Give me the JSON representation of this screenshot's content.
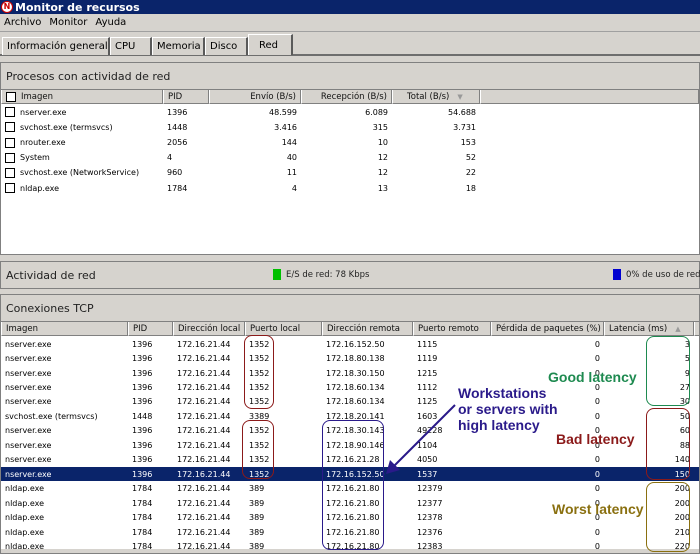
{
  "window": {
    "title": "Monitor de recursos"
  },
  "menu": [
    "Archivo",
    "Monitor",
    "Ayuda"
  ],
  "tabs": [
    {
      "label": "Información general",
      "active": false
    },
    {
      "label": "CPU",
      "active": false
    },
    {
      "label": "Memoria",
      "active": false
    },
    {
      "label": "Disco",
      "active": false
    },
    {
      "label": "Red",
      "active": true
    }
  ],
  "processes": {
    "title": "Procesos con actividad de red",
    "columns": [
      "Imagen",
      "PID",
      "Envío (B/s)",
      "Recepción (B/s)",
      "Total (B/s)"
    ],
    "sorted_column": "Total (B/s)",
    "rows": [
      [
        "nserver.exe",
        "1396",
        "48.599",
        "6.089",
        "54.688"
      ],
      [
        "svchost.exe (termsvcs)",
        "1448",
        "3.416",
        "315",
        "3.731"
      ],
      [
        "nrouter.exe",
        "2056",
        "144",
        "10",
        "153"
      ],
      [
        "System",
        "4",
        "40",
        "12",
        "52"
      ],
      [
        "svchost.exe (NetworkService)",
        "960",
        "11",
        "12",
        "22"
      ],
      [
        "nldap.exe",
        "1784",
        "4",
        "13",
        "18"
      ]
    ]
  },
  "activity": {
    "title": "Actividad de red",
    "io_label": "E/S de red: 78 Kbps",
    "usage_label": "0% de uso de red",
    "io_color": "#00c000",
    "usage_color": "#0000d0"
  },
  "tcp": {
    "title": "Conexiones TCP",
    "columns": [
      "Imagen",
      "PID",
      "Dirección local",
      "Puerto local",
      "Dirección remota",
      "Puerto remoto",
      "Pérdida de paquetes (%)",
      "Latencia (ms)"
    ],
    "sorted_column": "Latencia (ms)",
    "selected_row": 9,
    "rows": [
      [
        "nserver.exe",
        "1396",
        "172.16.21.44",
        "1352",
        "172.16.152.50",
        "1115",
        "0",
        "3"
      ],
      [
        "nserver.exe",
        "1396",
        "172.16.21.44",
        "1352",
        "172.18.80.138",
        "1119",
        "0",
        "5"
      ],
      [
        "nserver.exe",
        "1396",
        "172.16.21.44",
        "1352",
        "172.18.30.150",
        "1215",
        "0",
        "9"
      ],
      [
        "nserver.exe",
        "1396",
        "172.16.21.44",
        "1352",
        "172.18.60.134",
        "1112",
        "0",
        "27"
      ],
      [
        "nserver.exe",
        "1396",
        "172.16.21.44",
        "1352",
        "172.18.60.134",
        "1125",
        "0",
        "30"
      ],
      [
        "svchost.exe (termsvcs)",
        "1448",
        "172.16.21.44",
        "3389",
        "172.18.20.141",
        "1603",
        "0",
        "50"
      ],
      [
        "nserver.exe",
        "1396",
        "172.16.21.44",
        "1352",
        "172.18.30.143",
        "49228",
        "0",
        "60"
      ],
      [
        "nserver.exe",
        "1396",
        "172.16.21.44",
        "1352",
        "172.18.90.146",
        "1104",
        "0",
        "88"
      ],
      [
        "nserver.exe",
        "1396",
        "172.16.21.44",
        "1352",
        "172.16.21.28",
        "4050",
        "0",
        "140"
      ],
      [
        "nserver.exe",
        "1396",
        "172.16.21.44",
        "1352",
        "172.16.152.50",
        "1537",
        "0",
        "150"
      ],
      [
        "nldap.exe",
        "1784",
        "172.16.21.44",
        "389",
        "172.16.21.80",
        "12379",
        "0",
        "200"
      ],
      [
        "nldap.exe",
        "1784",
        "172.16.21.44",
        "389",
        "172.16.21.80",
        "12377",
        "0",
        "200"
      ],
      [
        "nldap.exe",
        "1784",
        "172.16.21.44",
        "389",
        "172.16.21.80",
        "12378",
        "0",
        "200"
      ],
      [
        "nldap.exe",
        "1784",
        "172.16.21.44",
        "389",
        "172.16.21.80",
        "12376",
        "0",
        "210"
      ],
      [
        "nldap.exe",
        "1784",
        "172.16.21.44",
        "389",
        "172.16.21.80",
        "12383",
        "0",
        "220"
      ]
    ]
  },
  "annotations": {
    "good": {
      "text": "Good latency",
      "color": "#1e8a50"
    },
    "bad": {
      "text": "Bad latency",
      "color": "#8b1a1a"
    },
    "worst": {
      "text": "Worst latency",
      "color": "#8a7010"
    },
    "workstations": {
      "text": "Workstations or servers with high latency",
      "color": "#2a1a8a"
    },
    "port_box_color": "#8b1a1a"
  }
}
